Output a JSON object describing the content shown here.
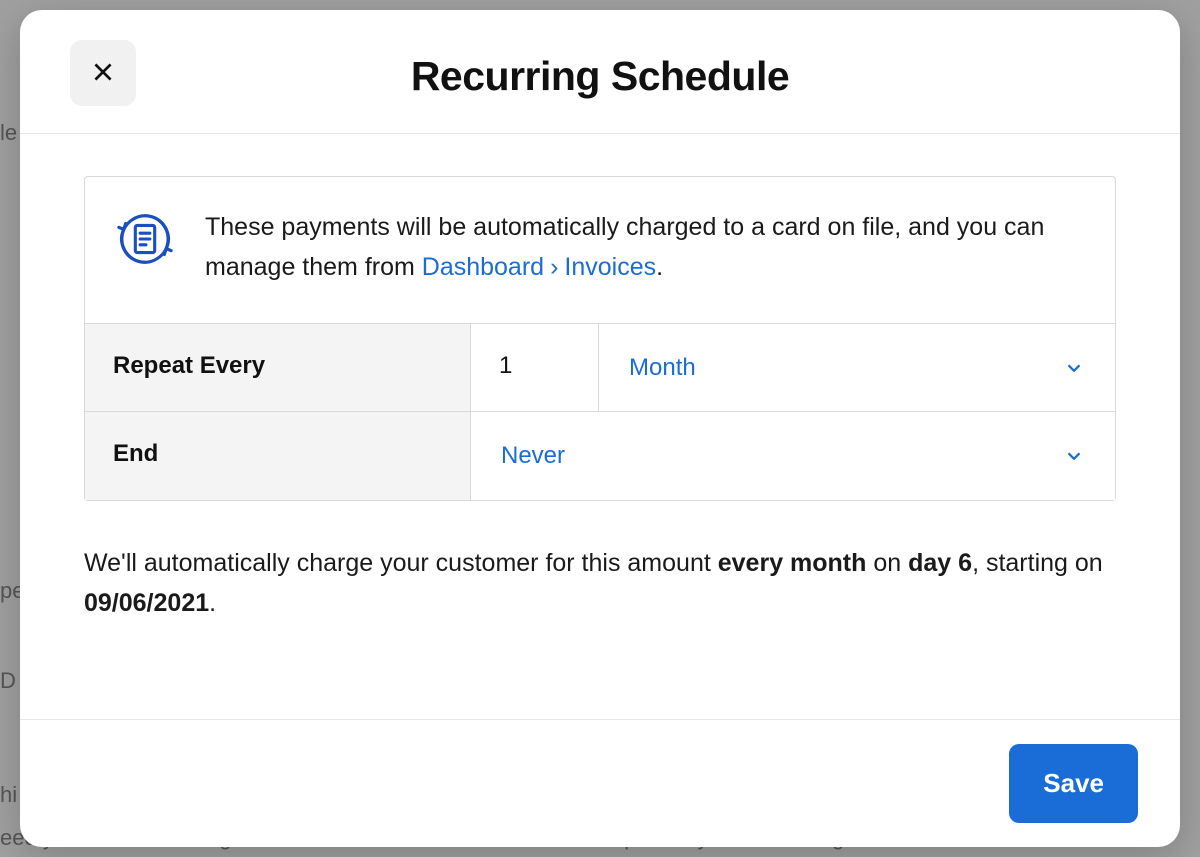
{
  "backdrop": {
    "line1": "le",
    "line2": "pe",
    "line3": "D",
    "line4": "hi",
    "line5": "eed your customer's signed authorisation to save their card and protect you from chargeback lia"
  },
  "modal": {
    "title": "Recurring Schedule",
    "info": {
      "text_part1": "These payments will be automatically charged to a card on file, and you can manage them from ",
      "link1": "Dashboard",
      "sep": "›",
      "link2": "Invoices",
      "text_end": "."
    },
    "rows": {
      "repeat_label": "Repeat Every",
      "repeat_value": "1",
      "repeat_unit": "Month",
      "end_label": "End",
      "end_value": "Never"
    },
    "summary": {
      "prefix": "We'll automatically charge your customer for this amount ",
      "freq": "every month",
      "mid1": " on ",
      "day": "day 6",
      "mid2": ", starting on ",
      "date": "09/06/2021",
      "suffix": "."
    },
    "footer": {
      "save": "Save"
    }
  }
}
